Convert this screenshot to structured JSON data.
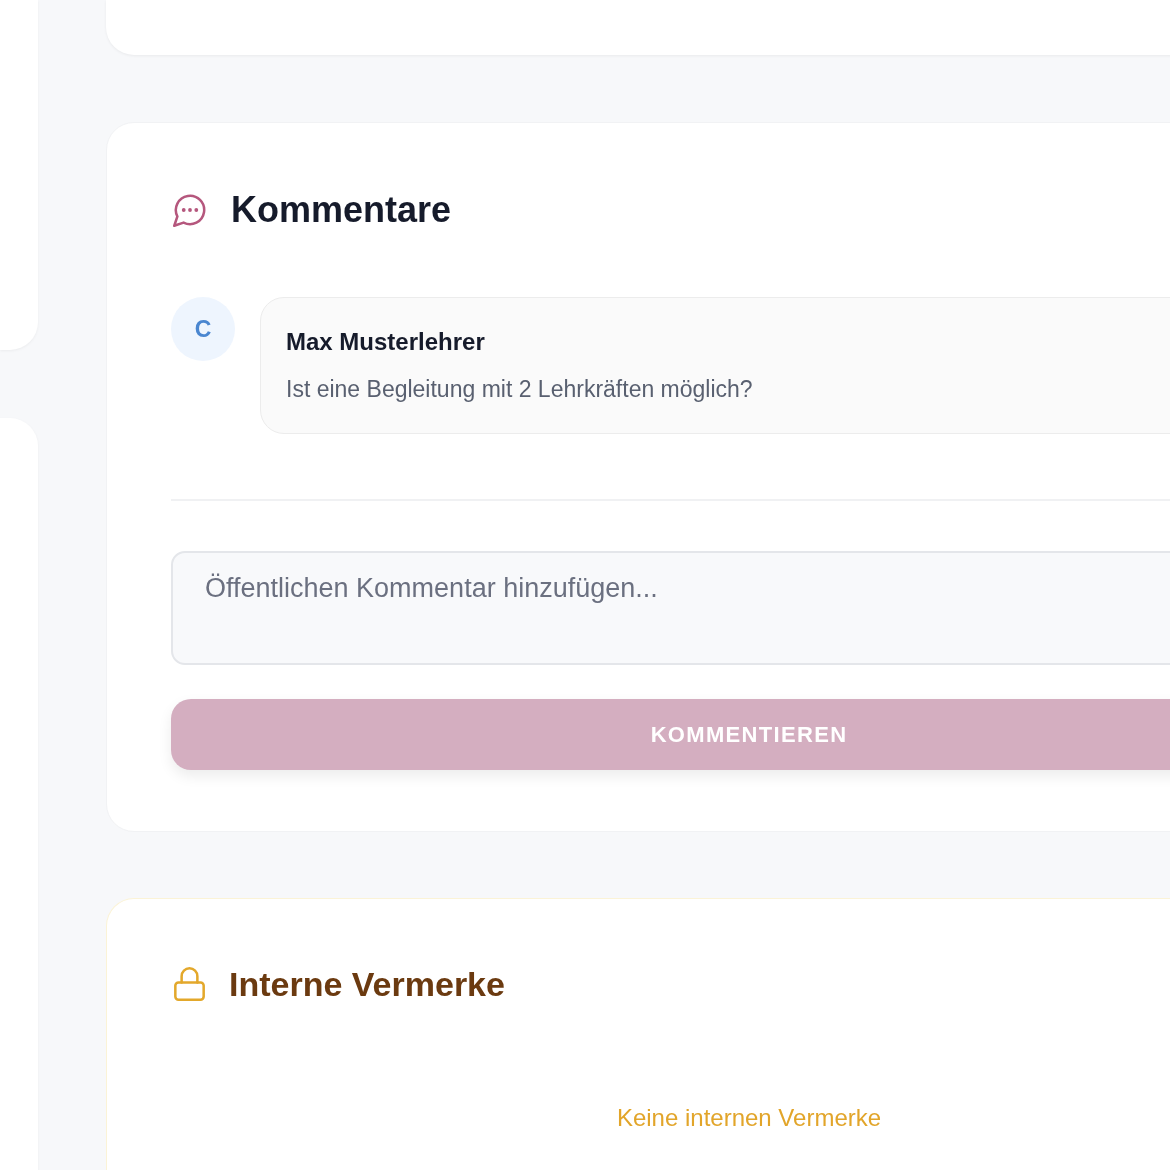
{
  "comments_section": {
    "title": "Kommentare",
    "comments": [
      {
        "avatar_initial": "C",
        "author": "Max Musterlehrer",
        "text": "Ist eine Begleitung mit 2 Lehrkräften möglich?"
      }
    ],
    "input": {
      "placeholder": "Öffentlichen Kommentar hinzufügen..."
    },
    "submit_button": {
      "label": "KOMMENTIEREN",
      "disabled": true
    }
  },
  "internal_notes_section": {
    "title": "Interne Vermerke",
    "empty_message": "Keine internen Vermerke"
  }
}
